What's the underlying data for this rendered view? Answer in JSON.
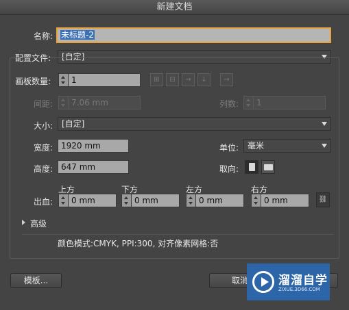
{
  "window": {
    "title": "新建文档"
  },
  "name": {
    "label": "名称:",
    "value": "未标题-2"
  },
  "profile": {
    "label": "配置文件:",
    "value": "[自定]"
  },
  "artboards": {
    "label": "画板数量:",
    "value": "1",
    "arrow_icons": [
      "grid-by-row-icon",
      "grid-by-column-icon",
      "arrange-by-row-icon",
      "arrange-by-column-icon"
    ],
    "direction_icon": "right-to-left-layout-icon"
  },
  "spacing": {
    "label": "间距:",
    "value": "7.06 mm"
  },
  "columns": {
    "label": "列数:",
    "value": "1"
  },
  "size": {
    "label": "大小:",
    "value": "[自定]"
  },
  "width": {
    "label": "宽度:",
    "value": "1920 mm"
  },
  "height": {
    "label": "高度:",
    "value": "647 mm"
  },
  "units": {
    "label": "单位:",
    "value": "毫米"
  },
  "orientation": {
    "label": "取向:",
    "selected": "portrait"
  },
  "bleed": {
    "label": "出血:",
    "top": {
      "label": "上方",
      "value": "0 mm"
    },
    "bottom": {
      "label": "下方",
      "value": "0 mm"
    },
    "left": {
      "label": "左方",
      "value": "0 mm"
    },
    "right": {
      "label": "右方",
      "value": "0 mm"
    },
    "link_icon": "chain-link-icon"
  },
  "advanced": {
    "label": "高级",
    "summary": "颜色模式:CMYK, PPI:300, 对齐像素网格:否"
  },
  "buttons": {
    "templates": "模板...",
    "cancel": "取消"
  },
  "watermark": {
    "title": "溜溜自学",
    "url": "ZIXUE.3D66.COM"
  },
  "colors": {
    "background": "#444444",
    "focus_ring": "#e8a33c",
    "selection": "#3d6fb5",
    "watermark": "#2d66a8"
  }
}
